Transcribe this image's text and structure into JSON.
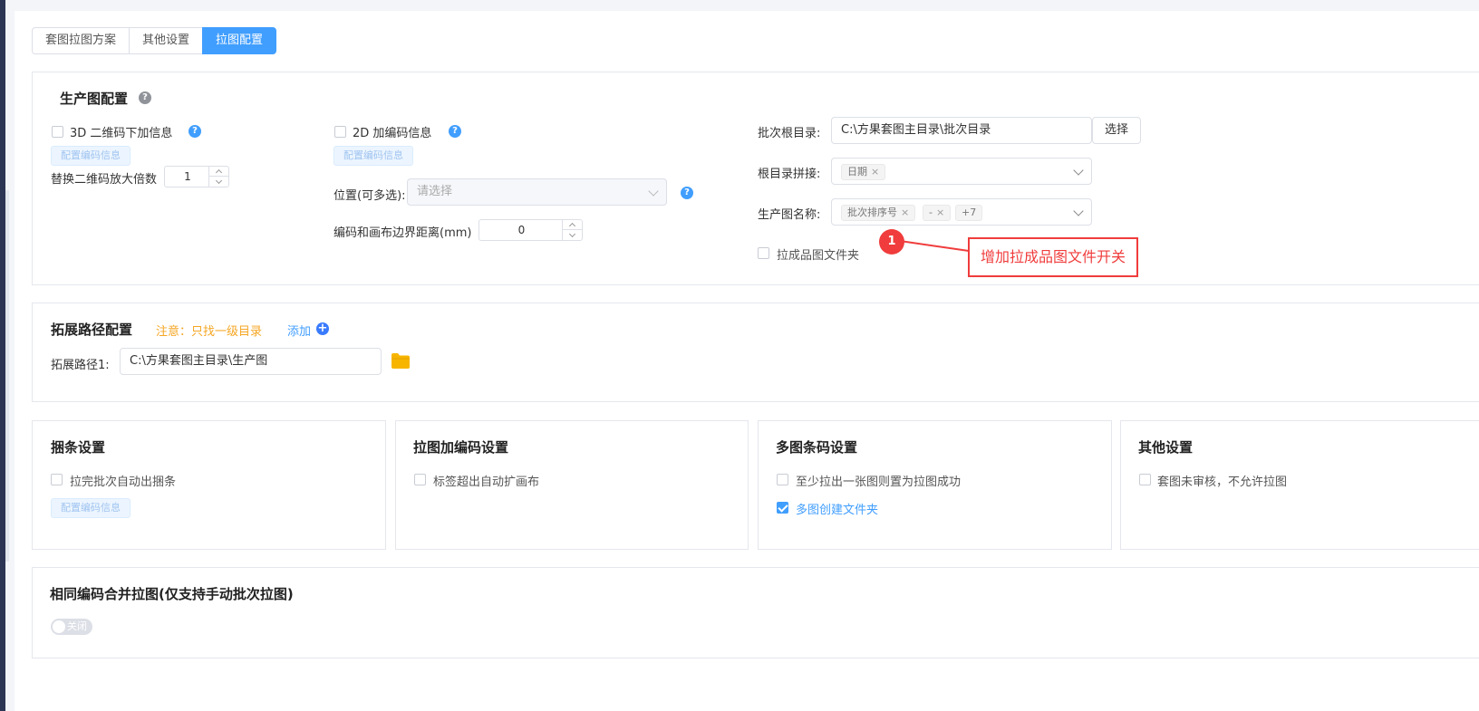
{
  "tabs": [
    "套图拉图方案",
    "其他设置",
    "拉图配置"
  ],
  "production": {
    "title": "生产图配置",
    "qr3d_label": "3D 二维码下加信息",
    "code2d_label": "2D 加编码信息",
    "config_code_btn": "配置编码信息",
    "replace_qr_label": "替换二维码放大倍数",
    "replace_qr_value": "1",
    "position_label": "位置(可多选):",
    "position_placeholder": "请选择",
    "edge_distance_label": "编码和画布边界距离(mm)",
    "edge_distance_value": "0",
    "batch_root_label": "批次根目录:",
    "batch_root_value": "C:\\方果套图主目录\\批次目录",
    "select_btn": "选择",
    "root_join_label": "根目录拼接:",
    "root_join_tags": [
      "日期"
    ],
    "prod_name_label": "生产图名称:",
    "prod_name_tags": [
      "批次排序号",
      "-"
    ],
    "prod_name_more": "+7",
    "finished_folder_label": "拉成品图文件夹"
  },
  "annotation": {
    "number": "1",
    "text": "增加拉成品图文件开关",
    "color": "#f03c3c"
  },
  "ext_path": {
    "title": "拓展路径配置",
    "note": "注意：只找一级目录",
    "add_label": "添加",
    "path_label": "拓展路径1:",
    "path_value": "C:\\方果套图主目录\\生产图"
  },
  "bundle": {
    "title": "捆条设置",
    "auto_bundle_label": "拉完批次自动出捆条",
    "config_code_btn": "配置编码信息"
  },
  "pull_code": {
    "title": "拉图加编码设置",
    "auto_expand_label": "标签超出自动扩画布"
  },
  "multi_barcode": {
    "title": "多图条码设置",
    "at_least_one_label": "至少拉出一张图则置为拉图成功",
    "create_folder_label": "多图创建文件夹"
  },
  "other": {
    "title": "其他设置",
    "not_reviewed_label": "套图未审核，不允许拉图"
  },
  "merge": {
    "title": "相同编码合并拉图(仅支持手动批次拉图)",
    "toggle_label": "关闭"
  },
  "colors": {
    "primary": "#409eff",
    "warning": "#f5a623",
    "annotation": "#f03c3c"
  }
}
